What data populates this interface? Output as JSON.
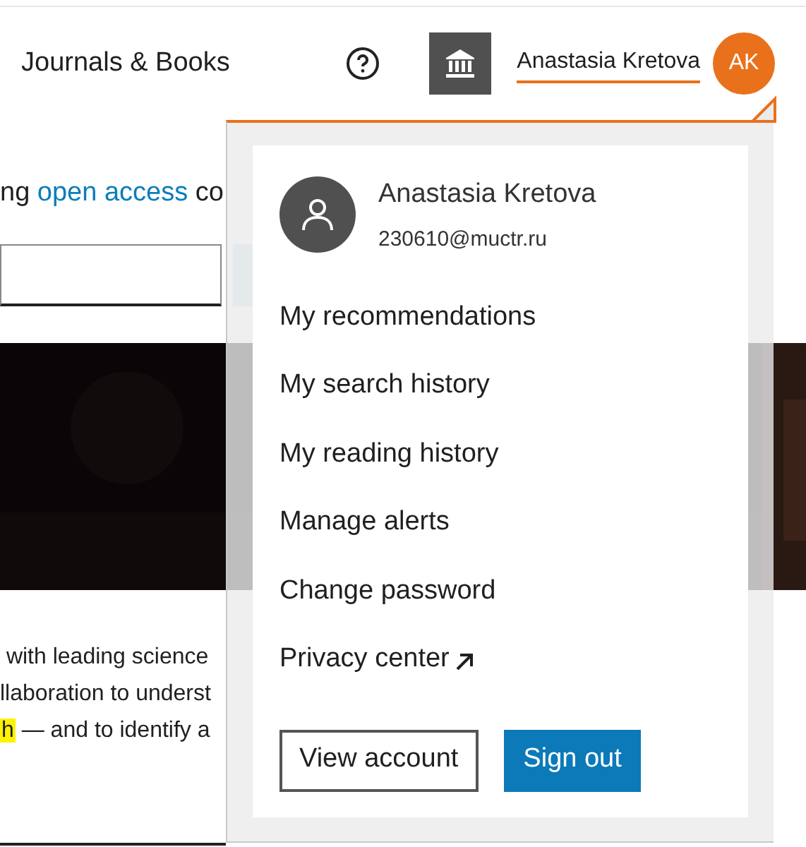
{
  "header": {
    "nav_link": "Journals & Books",
    "user_name": "Anastasia Kretova",
    "avatar_initials": "AK"
  },
  "page": {
    "intro": {
      "before": "ng ",
      "link": "open access",
      "after": " co"
    },
    "lines": [
      {
        "text": " with leading science"
      },
      {
        "text": "llaboration to underst"
      },
      {
        "highlight": "h",
        "text": " — and to identify a"
      }
    ]
  },
  "menu": {
    "name": "Anastasia Kretova",
    "email": "230610@muctr.ru",
    "items": [
      {
        "label": "My recommendations",
        "kind": "plain"
      },
      {
        "label": "My search history",
        "kind": "plain"
      },
      {
        "label": "My reading history",
        "kind": "plain"
      },
      {
        "label": "Manage alerts",
        "kind": "plain"
      },
      {
        "label": "Change password",
        "kind": "plain"
      },
      {
        "label": "Privacy center",
        "kind": "external"
      }
    ],
    "buttons": [
      {
        "label": "View account",
        "kind": "secondary"
      },
      {
        "label": "Sign out",
        "kind": "primary"
      }
    ]
  }
}
